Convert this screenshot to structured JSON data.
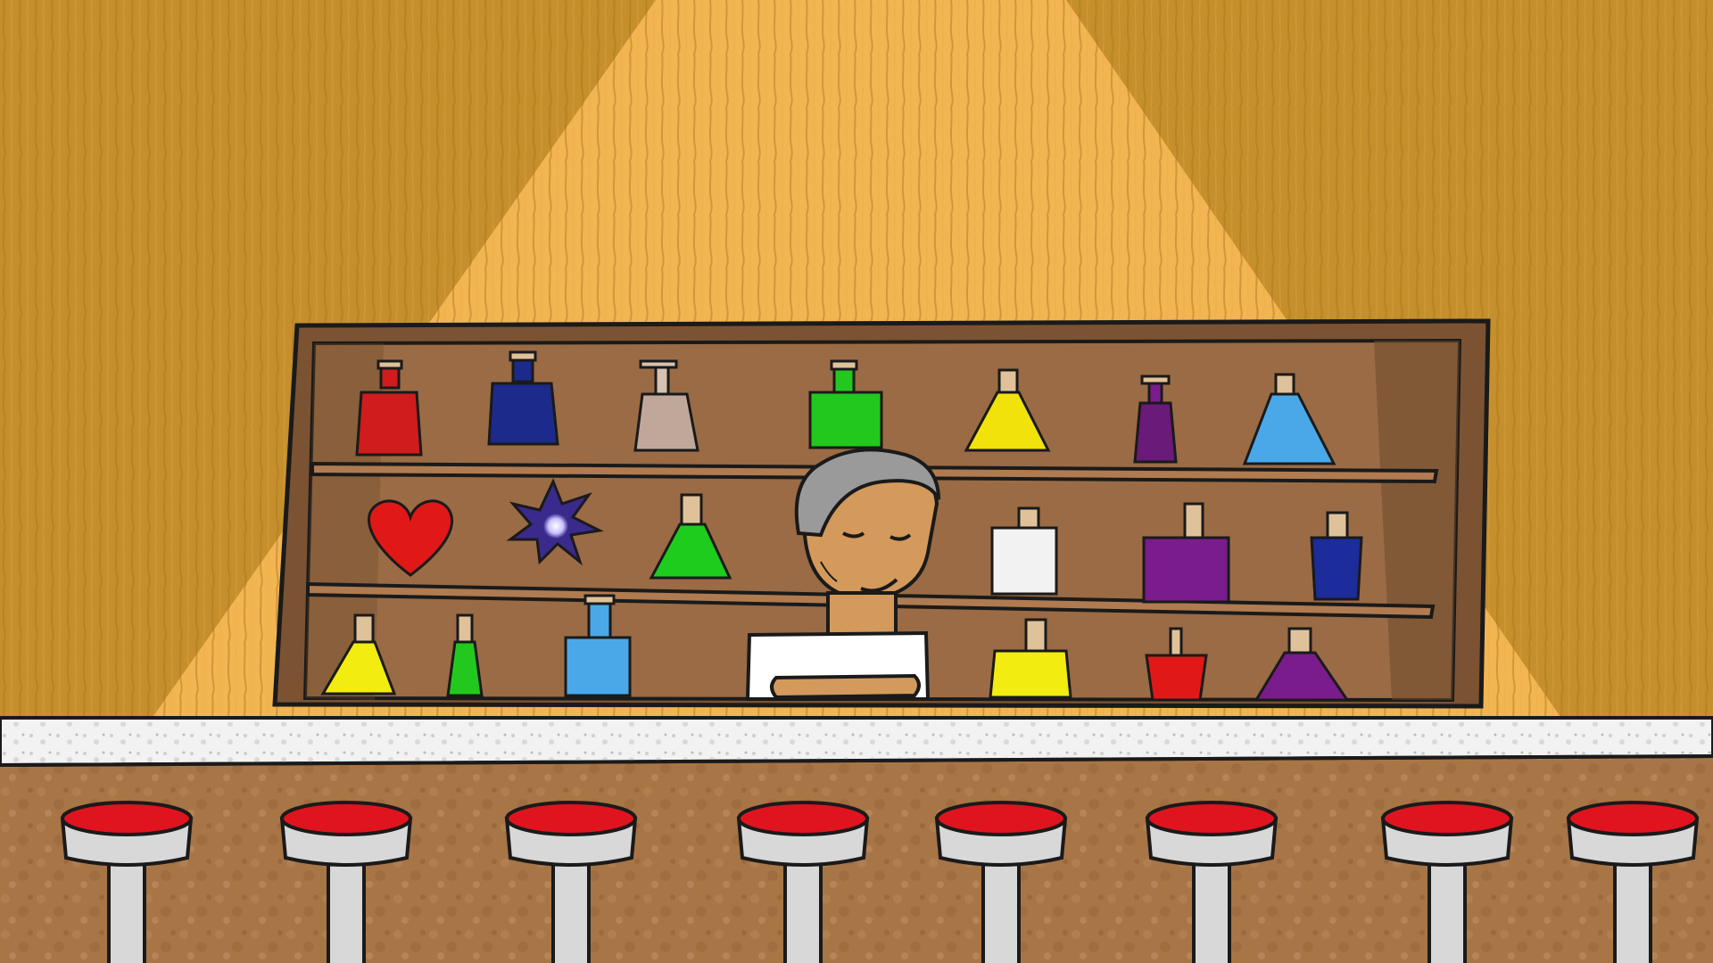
{
  "scene": {
    "title": "",
    "colors": {
      "wall": "#c58f2c",
      "wall_lit": "#f2b552",
      "shelf_wood": "#9a6b45",
      "shelf_dark": "#6e4a2c",
      "counter_top": "#f2f2f2",
      "counter_front": "#a87546",
      "stool_seat": "#e0141e",
      "stool_metal": "#d8d8d8",
      "outline": "#1a1a1a"
    },
    "shelf_items": [
      {
        "kind": "bottle",
        "color": "#d01c1c",
        "shelf": 1
      },
      {
        "kind": "bottle",
        "color": "#1c2a8c",
        "shelf": 1
      },
      {
        "kind": "pump-bottle",
        "color": "#bfa89a",
        "shelf": 1
      },
      {
        "kind": "bottle",
        "color": "#22c81e",
        "shelf": 1
      },
      {
        "kind": "flask",
        "color": "#f2e20c",
        "shelf": 1
      },
      {
        "kind": "pump-bottle",
        "color": "#6a1a78",
        "shelf": 1
      },
      {
        "kind": "flask",
        "color": "#4aa8e8",
        "shelf": 1
      },
      {
        "kind": "heart",
        "color": "#e01818",
        "shelf": 2
      },
      {
        "kind": "sparkle",
        "color": "#3a2a8c",
        "shelf": 2
      },
      {
        "kind": "flask",
        "color": "#1ecc1e",
        "shelf": 2
      },
      {
        "kind": "bottle",
        "color": "#f2f2f2",
        "shelf": 2
      },
      {
        "kind": "bottle",
        "color": "#7a1c8c",
        "shelf": 2
      },
      {
        "kind": "bottle",
        "color": "#1c2c9a",
        "shelf": 2
      },
      {
        "kind": "flask",
        "color": "#f2ec10",
        "shelf": 3
      },
      {
        "kind": "bottle",
        "color": "#22c81e",
        "shelf": 3
      },
      {
        "kind": "bottle",
        "color": "#4aa8e8",
        "shelf": 3
      },
      {
        "kind": "bottle",
        "color": "#f2ec10",
        "shelf": 3
      },
      {
        "kind": "cup",
        "color": "#e01818",
        "shelf": 3
      },
      {
        "kind": "flask",
        "color": "#7a1c8c",
        "shelf": 3
      }
    ],
    "stool_count": 8,
    "character": {
      "role": "bartender",
      "hair": "#9a9a9a",
      "skin": "#d39a5c",
      "shirt": "#ffffff"
    }
  }
}
